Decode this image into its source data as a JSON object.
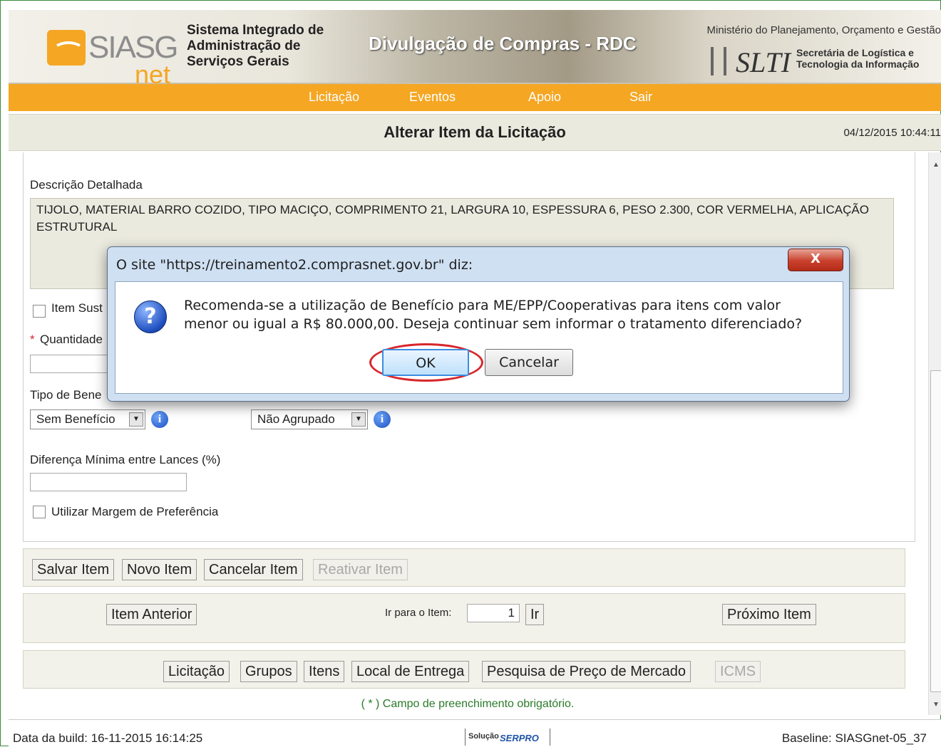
{
  "header": {
    "logo_siasg": "SIASG",
    "logo_net": "net",
    "system_name": "Sistema Integrado de Administração de Serviços Gerais",
    "portal_title": "Divulgação de Compras - RDC",
    "ministry": "Ministério do Planejamento, Orçamento e Gestão",
    "slti": "SLTI",
    "slti_name": "Secretária de Logística e Tecnologia da Informação"
  },
  "menu": {
    "items": [
      "Licitação",
      "Eventos",
      "Apoio",
      "Sair"
    ]
  },
  "titlebar": {
    "title": "Alterar Item da Licitação",
    "datetime": "04/12/2015 10:44:11"
  },
  "form": {
    "descricao_label": "Descrição Detalhada",
    "descricao_value": "TIJOLO, MATERIAL BARRO COZIDO, TIPO MACIÇO, COMPRIMENTO 21, LARGURA 10, ESPESSURA 6, PESO 2.300, COR VERMELHA, APLICAÇÃO ESTRUTURAL",
    "item_sust_label": "Item Sust",
    "quantidade_required": "*",
    "quantidade_label": "Quantidade",
    "tipo_beneficio_label": "Tipo de Bene",
    "beneficio_selected": "Sem Benefício",
    "agrupamento_selected": "Não Agrupado",
    "diferenca_label": "Diferença Mínima entre Lances (%)",
    "margem_label": "Utilizar Margem de Preferência"
  },
  "actions": {
    "salvar": "Salvar Item",
    "novo": "Novo Item",
    "cancelar": "Cancelar Item",
    "reativar": "Reativar Item"
  },
  "navigation": {
    "anterior": "Item Anterior",
    "ir_para_label": "Ir para o Item:",
    "ir_para_value": "1",
    "ir": "Ir",
    "proximo": "Próximo Item"
  },
  "sections": [
    "Licitação",
    "Grupos",
    "Itens",
    "Local de Entrega",
    "Pesquisa de Preço de Mercado",
    "ICMS"
  ],
  "footnote": "( * ) Campo de preenchimento obrigatório.",
  "status": {
    "build": "Data da build: 16-11-2015 16:14:25",
    "solucao": "Solução",
    "serpro": "SERPRO",
    "baseline": "Baseline: SIASGnet-05_37"
  },
  "dialog": {
    "title": "O site \"https://treinamento2.comprasnet.gov.br\" diz:",
    "close": "X",
    "message": "Recomenda-se a utilização de Benefício para ME/EPP/Cooperativas para itens com valor menor ou igual a R$ 80.000,00. Deseja continuar sem informar o tratamento diferenciado?",
    "ok": "OK",
    "cancel": "Cancelar",
    "icon": "question-icon"
  },
  "colors": {
    "menu_orange": "#f5a623",
    "footnote_green": "#2a7a2a",
    "highlight_red": "#d7262b"
  }
}
